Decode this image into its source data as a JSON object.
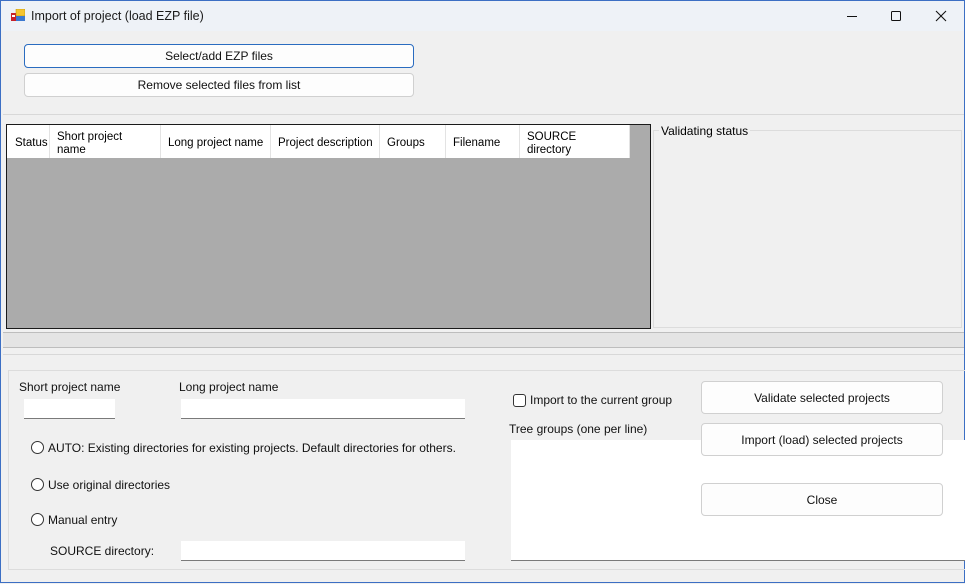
{
  "window": {
    "title": "Import of project (load EZP file)",
    "icons": {
      "app": "app-window-icon",
      "minimize": "minimize-icon",
      "maximize": "maximize-icon",
      "close": "close-icon"
    }
  },
  "toolbar": {
    "select_add_label": "Select/add EZP files",
    "remove_label": "Remove selected files from list"
  },
  "grid": {
    "columns": [
      {
        "label": "Status"
      },
      {
        "label": "Short project name"
      },
      {
        "label": "Long project name"
      },
      {
        "label": "Project description"
      },
      {
        "label": "Groups"
      },
      {
        "label": "Filename"
      },
      {
        "label": "SOURCE directory"
      }
    ],
    "rows": []
  },
  "validating_status": {
    "label": "Validating status"
  },
  "form": {
    "short_name_label": "Short project name",
    "short_name_value": "",
    "long_name_label": "Long project name",
    "long_name_value": "",
    "radio_options": [
      {
        "label": "AUTO: Existing directories for existing projects. Default directories for others.",
        "checked": false
      },
      {
        "label": "Use original directories",
        "checked": false
      },
      {
        "label": "Manual entry",
        "checked": false
      }
    ],
    "source_dir_label": "SOURCE directory:",
    "source_dir_value": "",
    "import_current_group_label": "Import to the current group",
    "import_current_group_checked": false,
    "tree_groups_label": "Tree groups (one per line)",
    "tree_groups_value": ""
  },
  "actions": {
    "validate_label": "Validate selected projects",
    "import_label": "Import (load) selected projects",
    "close_label": "Close"
  }
}
